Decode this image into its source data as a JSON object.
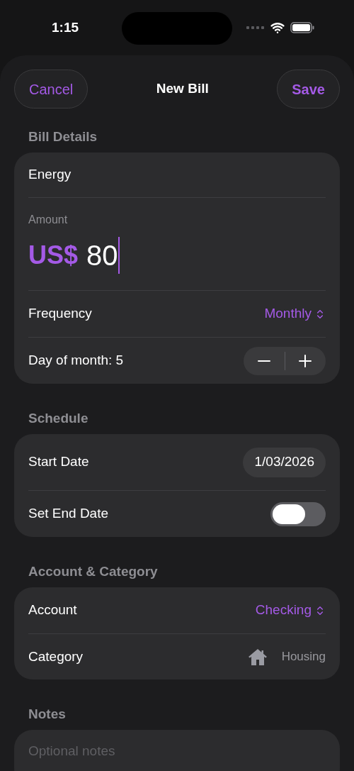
{
  "status_bar": {
    "time": "1:15"
  },
  "nav": {
    "cancel": "Cancel",
    "title": "New Bill",
    "save": "Save"
  },
  "sections": [
    {
      "header": "Bill Details",
      "rows": [
        {
          "kind": "text",
          "value": "Energy"
        },
        {
          "kind": "amount",
          "label": "Amount",
          "currency": "US$",
          "value": "80"
        },
        {
          "kind": "picker",
          "label": "Frequency",
          "value": "Monthly"
        },
        {
          "kind": "stepper",
          "label": "Day of month: 5"
        }
      ]
    },
    {
      "header": "Schedule",
      "rows": [
        {
          "kind": "date",
          "label": "Start Date",
          "value": "1/03/2026"
        },
        {
          "kind": "toggle",
          "label": "Set End Date",
          "on": false
        }
      ]
    },
    {
      "header": "Account & Category",
      "rows": [
        {
          "kind": "picker",
          "label": "Account",
          "value": "Checking"
        },
        {
          "kind": "category",
          "label": "Category",
          "value": "Housing"
        }
      ]
    },
    {
      "header": "Notes",
      "rows": [
        {
          "kind": "notes",
          "placeholder": "Optional notes"
        }
      ]
    }
  ]
}
